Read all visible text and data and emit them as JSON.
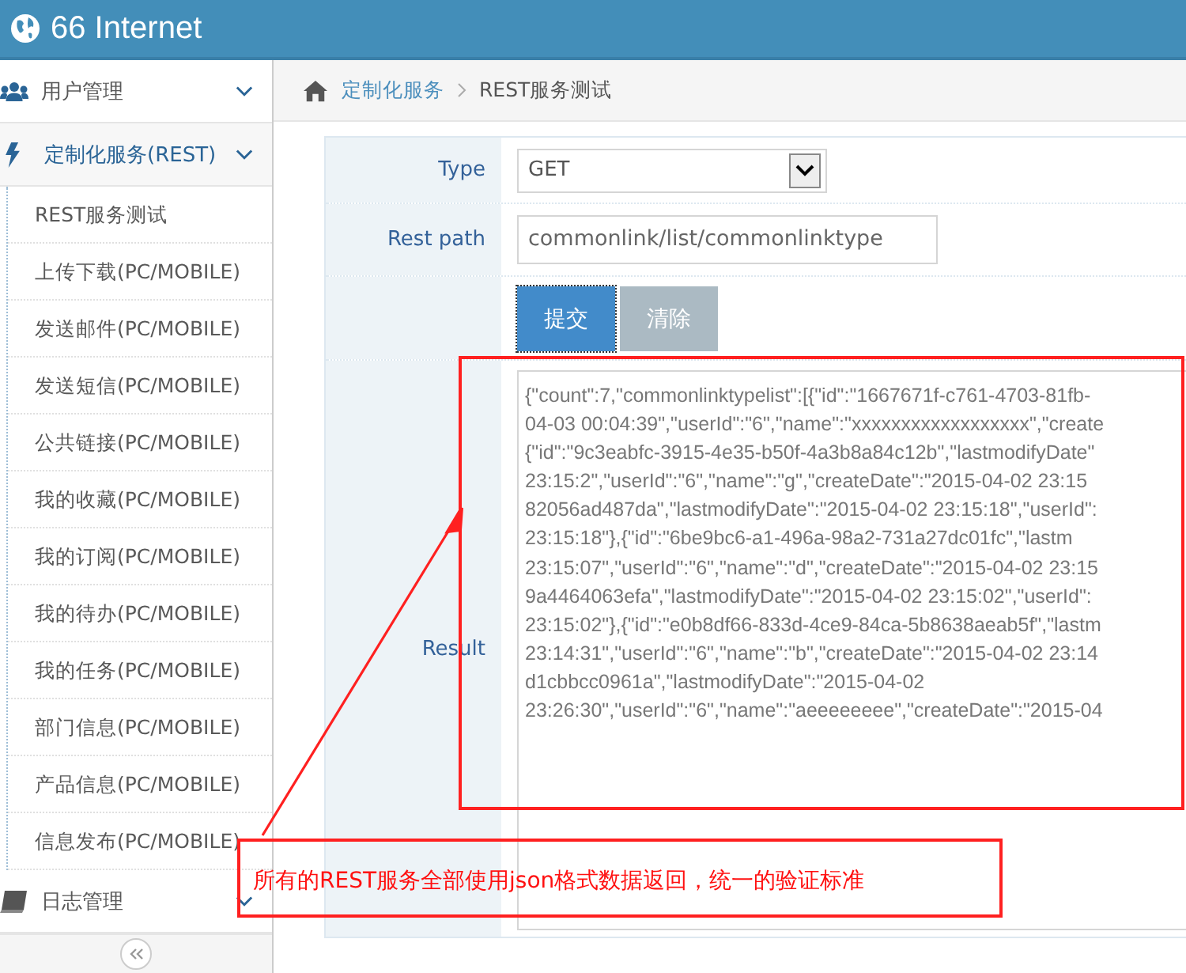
{
  "header": {
    "title": "66 Internet"
  },
  "sidebar": {
    "items": [
      {
        "label": "用户管理",
        "kind": "users",
        "selected": false
      },
      {
        "label": "定制化服务(REST)",
        "kind": "service",
        "selected": true,
        "children": [
          "REST服务测试",
          "上传下载(PC/MOBILE)",
          "发送邮件(PC/MOBILE)",
          "发送短信(PC/MOBILE)",
          "公共链接(PC/MOBILE)",
          "我的收藏(PC/MOBILE)",
          "我的订阅(PC/MOBILE)",
          "我的待办(PC/MOBILE)",
          "我的任务(PC/MOBILE)",
          "部门信息(PC/MOBILE)",
          "产品信息(PC/MOBILE)",
          "信息发布(PC/MOBILE)"
        ]
      },
      {
        "label": "日志管理",
        "kind": "log",
        "selected": false
      }
    ]
  },
  "breadcrumb": [
    "定制化服务",
    "REST服务测试"
  ],
  "form": {
    "type_label": "Type",
    "type_value": "GET",
    "path_label": "Rest path",
    "path_value": "commonlink/list/commonlinktype",
    "buttons": [
      {
        "label": "提交",
        "kind": "primary"
      },
      {
        "label": "清除",
        "kind": "secondary"
      }
    ],
    "result_label": "Result",
    "result_text": "{\"count\":7,\"commonlinktypelist\":[{\"id\":\"1667671f-c761-4703-81fb-\n04-03 00:04:39\",\"userId\":\"6\",\"name\":\"xxxxxxxxxxxxxxxxxx\",\"create\n{\"id\":\"9c3eabfc-3915-4e35-b50f-4a3b8a84c12b\",\"lastmodifyDate\"\n23:15:2\",\"userId\":\"6\",\"name\":\"g\",\"createDate\":\"2015-04-02 23:15\n82056ad487da\",\"lastmodifyDate\":\"2015-04-02 23:15:18\",\"userId\":\n23:15:18\"},{\"id\":\"6be9bc6-a1-496a-98a2-731a27dc01fc\",\"lastm\n23:15:07\",\"userId\":\"6\",\"name\":\"d\",\"createDate\":\"2015-04-02 23:15\n9a4464063efa\",\"lastmodifyDate\":\"2015-04-02 23:15:02\",\"userId\":\n23:15:02\"},{\"id\":\"e0b8df66-833d-4ce9-84ca-5b8638aeab5f\",\"lastm\n23:14:31\",\"userId\":\"6\",\"name\":\"b\",\"createDate\":\"2015-04-02 23:14\nd1cbbcc0961a\",\"lastmodifyDate\":\"2015-04-02\n23:26:30\",\"userId\":\"6\",\"name\":\"aeeeeeeee\",\"createDate\":\"2015-04"
  },
  "annotation": {
    "text": "所有的REST服务全部使用json格式数据返回，统一的验证标准"
  }
}
